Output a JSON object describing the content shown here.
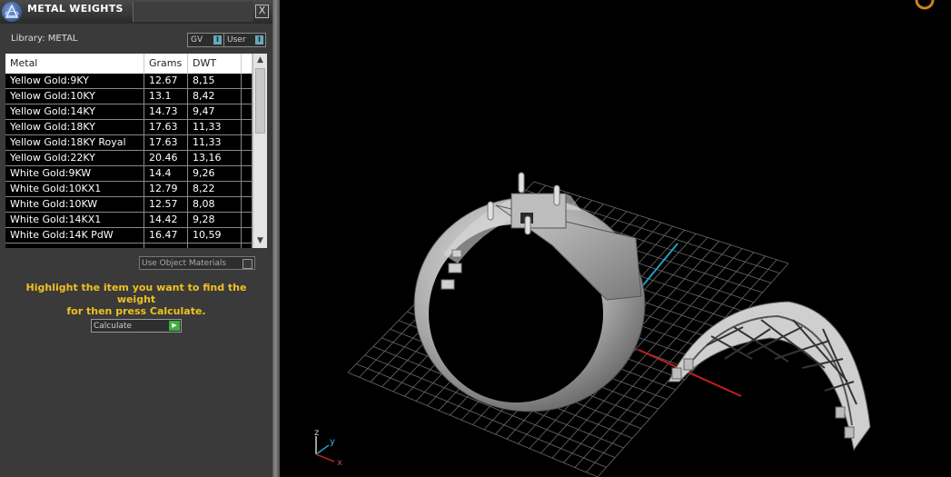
{
  "panel": {
    "title": "METAL WEIGHTS",
    "close_label": "X",
    "library_label": "Library: METAL",
    "gv_label": "GV",
    "user_label": "User",
    "indicator": "I",
    "use_object_materials": "Use Object Materials",
    "instruction_line1": "Highlight the item you want to find the weight",
    "instruction_line2": "for then press Calculate.",
    "calculate_label": "Calculate"
  },
  "table": {
    "columns": [
      "Metal",
      "Grams",
      "DWT"
    ],
    "rows": [
      [
        "Yellow Gold:9KY",
        "12.67",
        "8,15"
      ],
      [
        "Yellow Gold:10KY",
        "13.1",
        "8,42"
      ],
      [
        "Yellow Gold:14KY",
        "14.73",
        "9,47"
      ],
      [
        "Yellow Gold:18KY",
        "17.63",
        "11,33"
      ],
      [
        "Yellow Gold:18KY Royal",
        "17.63",
        "11,33"
      ],
      [
        "Yellow Gold:22KY",
        "20.46",
        "13,16"
      ],
      [
        "White Gold:9KW",
        "14.4",
        "9,26"
      ],
      [
        "White Gold:10KX1",
        "12.79",
        "8,22"
      ],
      [
        "White Gold:10KW",
        "12.57",
        "8,08"
      ],
      [
        "White Gold:14KX1",
        "14.42",
        "9,28"
      ],
      [
        "White Gold:14K PdW",
        "16.47",
        "10,59"
      ]
    ]
  },
  "viewport": {
    "axis_labels": {
      "z": "z",
      "y": "y",
      "x": "x"
    },
    "colors": {
      "x_axis": "#c02020",
      "y_axis": "#20a0c0",
      "z_axis": "#d0d0d0",
      "grid": "#6a6a6a"
    }
  }
}
